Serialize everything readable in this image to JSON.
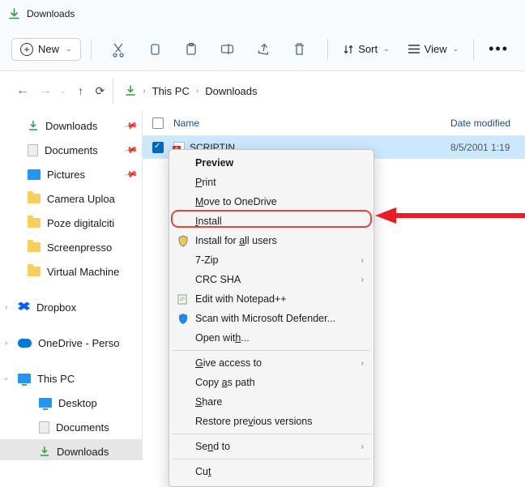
{
  "titlebar": {
    "title": "Downloads"
  },
  "toolbar": {
    "new_label": "New",
    "sort_label": "Sort",
    "view_label": "View"
  },
  "breadcrumb": {
    "root": "This PC",
    "current": "Downloads"
  },
  "sidebar": {
    "quick": [
      {
        "label": "Downloads",
        "pinned": true,
        "icon": "download"
      },
      {
        "label": "Documents",
        "pinned": true,
        "icon": "document"
      },
      {
        "label": "Pictures",
        "pinned": true,
        "icon": "image"
      },
      {
        "label": "Camera Uploa",
        "pinned": false,
        "icon": "folder"
      },
      {
        "label": "Poze digitalciti",
        "pinned": false,
        "icon": "folder"
      },
      {
        "label": "Screenpresso",
        "pinned": false,
        "icon": "folder"
      },
      {
        "label": "Virtual Machine",
        "pinned": false,
        "icon": "folder"
      }
    ],
    "dropbox": "Dropbox",
    "onedrive": "OneDrive - Perso",
    "this_pc": "This PC",
    "thispc_children": [
      {
        "label": "Desktop",
        "icon": "pc"
      },
      {
        "label": "Documents",
        "icon": "document"
      },
      {
        "label": "Downloads",
        "icon": "download",
        "selected": true
      }
    ]
  },
  "columns": {
    "name": "Name",
    "date": "Date modified"
  },
  "file": {
    "name": "SCRIPTIN",
    "date": "8/5/2001 1:19"
  },
  "context_menu": {
    "preview": "Preview",
    "print": "Print",
    "move_onedrive": "Move to OneDrive",
    "install": "Install",
    "install_all": "Install for all users",
    "seven_zip": "7-Zip",
    "crc_sha": "CRC SHA",
    "edit_npp": "Edit with Notepad++",
    "scan_defender": "Scan with Microsoft Defender...",
    "open_with": "Open with...",
    "give_access": "Give access to",
    "copy_path": "Copy as path",
    "share": "Share",
    "restore": "Restore previous versions",
    "send_to": "Send to",
    "cut": "Cut"
  },
  "annotation": {
    "highlighted_item": "install"
  }
}
